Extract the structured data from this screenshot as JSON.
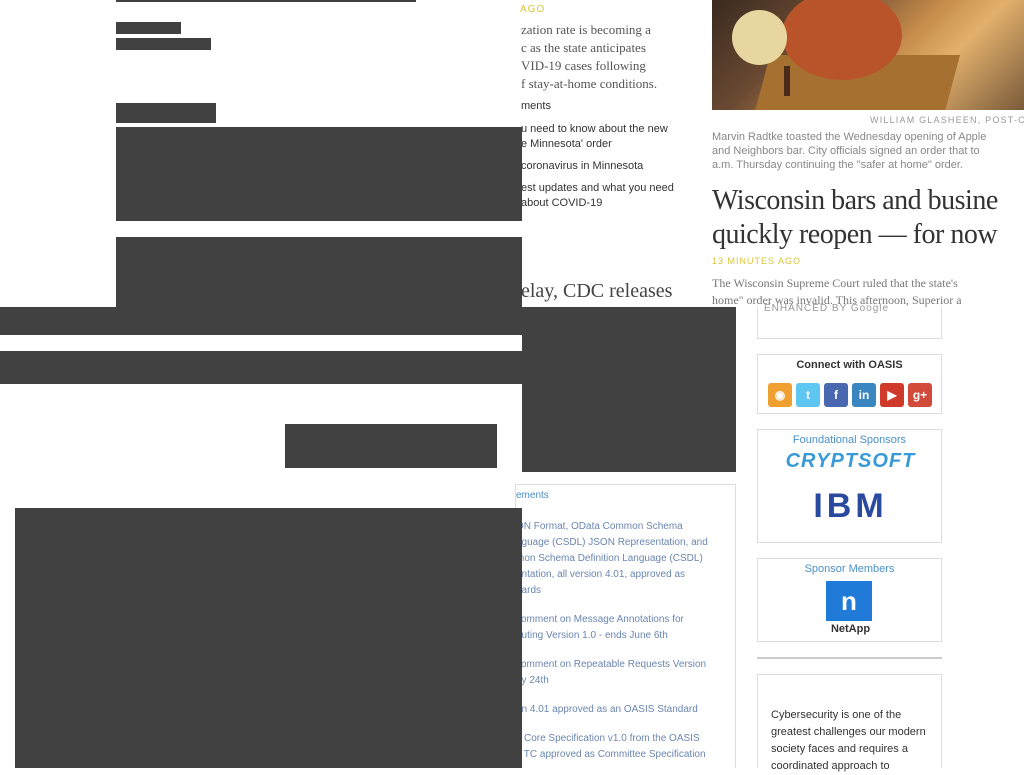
{
  "news": {
    "time_ago_top": "AGO",
    "lede_lines": [
      "zation rate is becoming a",
      "c as the state anticipates",
      "VID-19 cases following",
      "f stay-at-home conditions."
    ],
    "comments": "ments",
    "links": [
      "u need to know about the new",
      "e Minnesota' order",
      "coronavirus in Minnesota",
      "est updates and what you need",
      "about COVID-19"
    ],
    "cdc_headline": "elay, CDC releases",
    "photo_credit": "WILLIAM GLASHEEN, POST-CR",
    "photo_caption_lines": [
      "Marvin Radtke toasted the Wednesday opening of Apple",
      "and Neighbors bar. City officials signed an order that to",
      "a.m. Thursday continuing the \"safer at home\" order."
    ],
    "wi_headline_lines": [
      "Wisconsin bars and busine",
      "quickly reopen — for now"
    ],
    "wi_time_ago": "13 MINUTES AGO",
    "wi_body_lines": [
      "The Wisconsin Supreme Court ruled that the state's",
      "home\" order was invalid. This afternoon, Superior a"
    ]
  },
  "oasis": {
    "search_enhanced": "ENHANCED BY Google",
    "connect_title": "Connect with OASIS",
    "social_icons": [
      {
        "name": "rss-icon",
        "color": "#f0a030",
        "glyph": "◉"
      },
      {
        "name": "twitter-icon",
        "color": "#5ec6f0",
        "glyph": "t"
      },
      {
        "name": "facebook-icon",
        "color": "#4a68b0",
        "glyph": "f"
      },
      {
        "name": "linkedin-icon",
        "color": "#3a86c0",
        "glyph": "in"
      },
      {
        "name": "youtube-icon",
        "color": "#d03a2a",
        "glyph": "▶"
      },
      {
        "name": "google-plus-icon",
        "color": "#d24a3a",
        "glyph": "g+"
      }
    ],
    "foundational_title": "Foundational Sponsors",
    "sponsor1": "CRYPTSOFT",
    "sponsor2": "IBM",
    "sponsor_members_title": "Sponsor Members",
    "netapp": "NetApp",
    "announcements_title": "ements",
    "announcements": [
      "ON Format, OData Common Schema",
      "nguage (CSDL) JSON Representation, and",
      "mon Schema Definition Language (CSDL)",
      "entation, all version 4.01, approved as",
      "dards",
      "comment on Message Annotations for",
      "outing Version 1.0 - ends June 6th",
      "comment on Repeatable Requests Version",
      "ay 24th",
      "on 4.01 approved as an OASIS Standard",
      "L Core Specification v1.0 from the OASIS",
      "L TC approved as Committee Specification"
    ],
    "cyber_text_lines": [
      "Cybersecurity is one of the",
      "greatest challenges our modern",
      "society faces and requires a",
      "coordinated approach to"
    ]
  }
}
